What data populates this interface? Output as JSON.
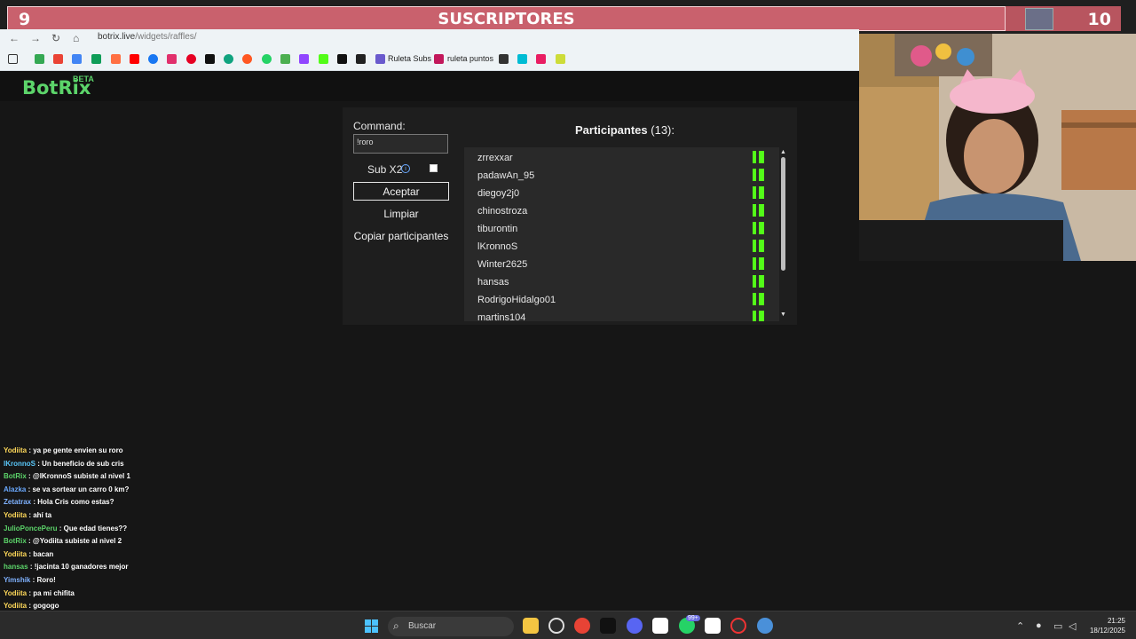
{
  "subscriber_bar": {
    "current_count": "9",
    "title": "SUSCRIPTORES",
    "goal_count": "10"
  },
  "browser": {
    "url_domain": "botrix.live",
    "url_path": "/widgets/raffles/",
    "bookmarks": [
      {
        "label": "Ruleta Subs"
      },
      {
        "label": "ruleta puntos"
      }
    ]
  },
  "app": {
    "logo": "BotRix",
    "badge": "BETA"
  },
  "raffle": {
    "command_label": "Command:",
    "command_value": "!roro",
    "subx2_label": "Sub X2",
    "info_glyph": "i",
    "accept_label": "Aceptar",
    "clear_label": "Limpiar",
    "copy_label": "Copiar participantes",
    "participants_title": "Participantes",
    "participants_count": "(13)",
    "participants_colon": ":",
    "participants": [
      "zrrexxar",
      "padawAn_95",
      "diegoy2j0",
      "chinostroza",
      "tiburontin",
      "lKronnoS",
      "Winter2625",
      "hansas",
      "RodrigoHidalgo01",
      "martins104"
    ]
  },
  "chat": [
    {
      "user": "Yodiita",
      "text": ": ya pe gente envien su roro",
      "color": "#ffd95a"
    },
    {
      "user": "lKronnoS",
      "text": ": Un beneficio de sub cris",
      "color": "#5ac8fa"
    },
    {
      "user": "BotRix",
      "text": ": @lKronnoS subiste al nivel 1",
      "color": "#5cd46a"
    },
    {
      "user": "Alazka",
      "text": ": se va sortear un carro 0 km?",
      "color": "#6aa9ff"
    },
    {
      "user": "Zetatrax",
      "text": ": Hola Cris como estas?",
      "color": "#7fb2ff"
    },
    {
      "user": "Yodiita",
      "text": ": ahí ta",
      "color": "#ffd95a"
    },
    {
      "user": "JulioPoncePeru",
      "text": ": Que edad tienes??",
      "color": "#5cd46a"
    },
    {
      "user": "BotRix",
      "text": ": @Yodiita subiste al nivel 2",
      "color": "#5cd46a"
    },
    {
      "user": "Yodiita",
      "text": ": bacan",
      "color": "#ffd95a"
    },
    {
      "user": "hansas",
      "text": ": !jacinta 10 ganadores mejor",
      "color": "#5cd46a"
    },
    {
      "user": "Yimshik",
      "text": ": Roro!",
      "color": "#7fb2ff"
    },
    {
      "user": "Yodiita",
      "text": ": pa mi chifita",
      "color": "#ffd95a"
    },
    {
      "user": "Yodiita",
      "text": ": gogogo",
      "color": "#ffd95a"
    }
  ],
  "taskbar": {
    "search_placeholder": "Buscar",
    "notification_badge": "99+",
    "time": "21:25",
    "date": "18/12/2025"
  }
}
